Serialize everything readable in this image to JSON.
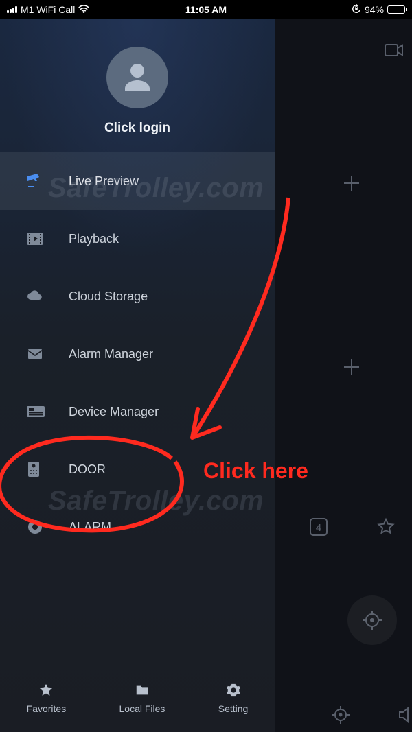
{
  "status": {
    "carrier": "M1 WiFi Call",
    "time": "11:05 AM",
    "battery_pct": "94%"
  },
  "profile": {
    "login_label": "Click login"
  },
  "menu": [
    {
      "label": "Live Preview"
    },
    {
      "label": "Playback"
    },
    {
      "label": "Cloud Storage"
    },
    {
      "label": "Alarm Manager"
    },
    {
      "label": "Device Manager"
    },
    {
      "label": "DOOR"
    },
    {
      "label": "ALARM"
    }
  ],
  "bottom": [
    {
      "label": "Favorites"
    },
    {
      "label": "Local Files"
    },
    {
      "label": "Setting"
    }
  ],
  "annotation": {
    "text": "Click here"
  },
  "watermark": "SafeTrolley.com"
}
